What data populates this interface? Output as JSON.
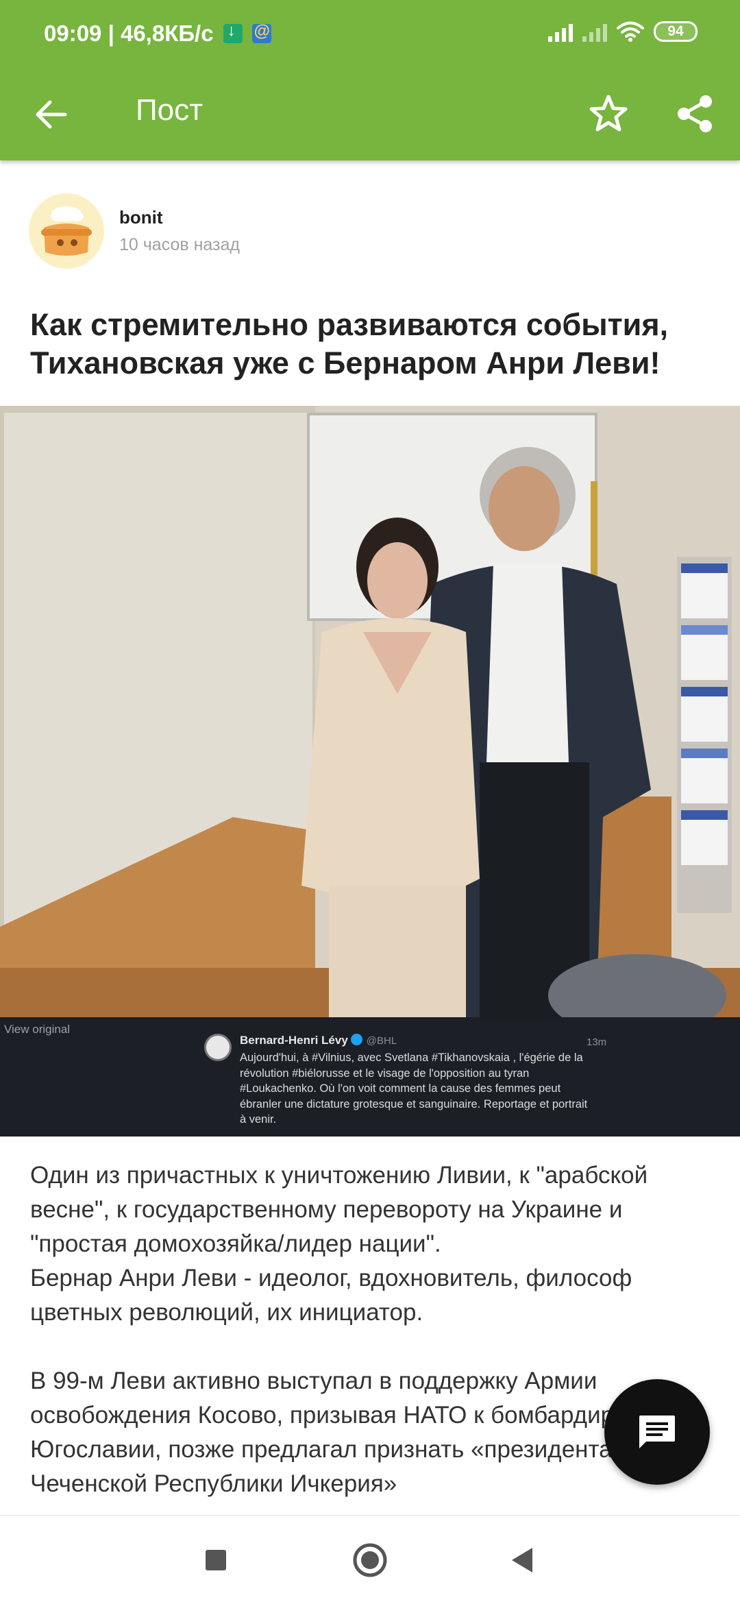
{
  "status_bar": {
    "time_speed": "09:09 | 46,8КБ/с",
    "battery": "94"
  },
  "app_bar": {
    "title": "Пост",
    "back_icon": "arrow-left-icon",
    "favorite_icon": "star-icon",
    "share_icon": "share-icon",
    "color": "#77b53e"
  },
  "author": {
    "name": "bonit",
    "time_ago": "10 часов назад"
  },
  "post": {
    "title": "Как стремительно развиваются события, Тихановская уже с Бернаром Анри Леви!",
    "tweet": {
      "view_original": "View original",
      "name": "Bernard-Henri Lévy",
      "handle": "@BHL",
      "time": "13m",
      "text": "Aujourd'hui, à #Vilnius, avec Svetlana #Tikhanovskaia , l'égérie de la révolution #biélorusse et le visage de l'opposition au tyran #Loukachenko. Où l'on voit comment la cause des femmes peut ébranler une dictature grotesque et sanguinaire. Reportage et portrait à venir."
    },
    "body": {
      "p1": "Один из причастных к уничтожению Ливии, к \"арабской весне\", к государственному перевороту на Украине и \"простая домохозяйка/лидер нации\".",
      "p2": "Бернар Анри Леви - идеолог, вдохновитель, философ цветных революций, их инициатор.",
      "p3": "В 99-м Леви активно выступал в поддержку Армии освобождения Косово, призывая НАТО к бомбардировкам Югославии,  позже предлагал признать «президента Чеченской Республики Ичкерия»"
    }
  },
  "fab": {
    "icon": "comment-icon"
  },
  "nav": {
    "icons": [
      "square-icon",
      "home-circle-icon",
      "back-triangle-icon"
    ]
  }
}
